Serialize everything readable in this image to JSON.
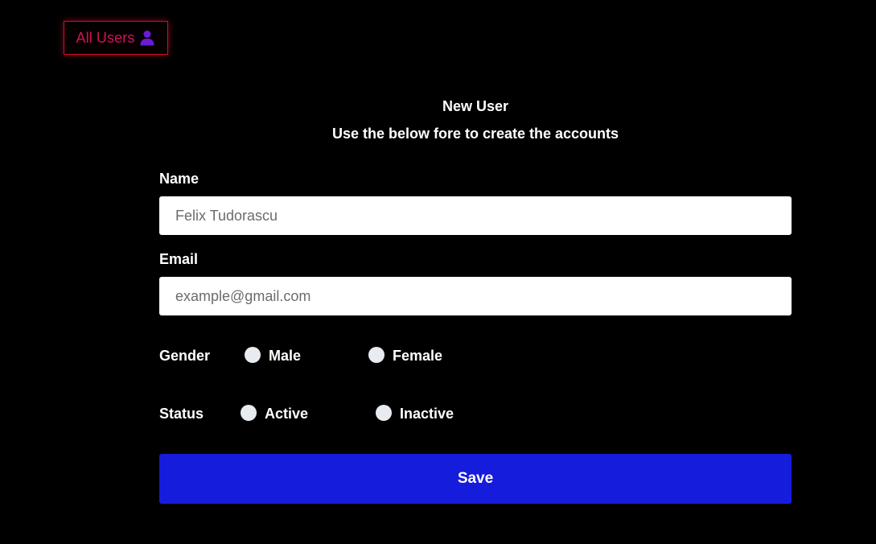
{
  "top_nav": {
    "all_users_label": "All Users",
    "icon": "user-icon",
    "colors": {
      "border": "#d0102a",
      "label": "#d2125a",
      "icon": "#6a1bd6"
    }
  },
  "form": {
    "title": "New User",
    "subtitle": "Use the below fore to create the accounts",
    "name": {
      "label": "Name",
      "value": "Felix Tudorascu",
      "placeholder": ""
    },
    "email": {
      "label": "Email",
      "value": "",
      "placeholder": "example@gmail.com"
    },
    "gender": {
      "label": "Gender",
      "options": [
        "Male",
        "Female"
      ],
      "selected": null
    },
    "status": {
      "label": "Status",
      "options": [
        "Active",
        "Inactive"
      ],
      "selected": null
    },
    "save_label": "Save",
    "colors": {
      "save_button": "#161cdc",
      "background": "#000000"
    }
  }
}
